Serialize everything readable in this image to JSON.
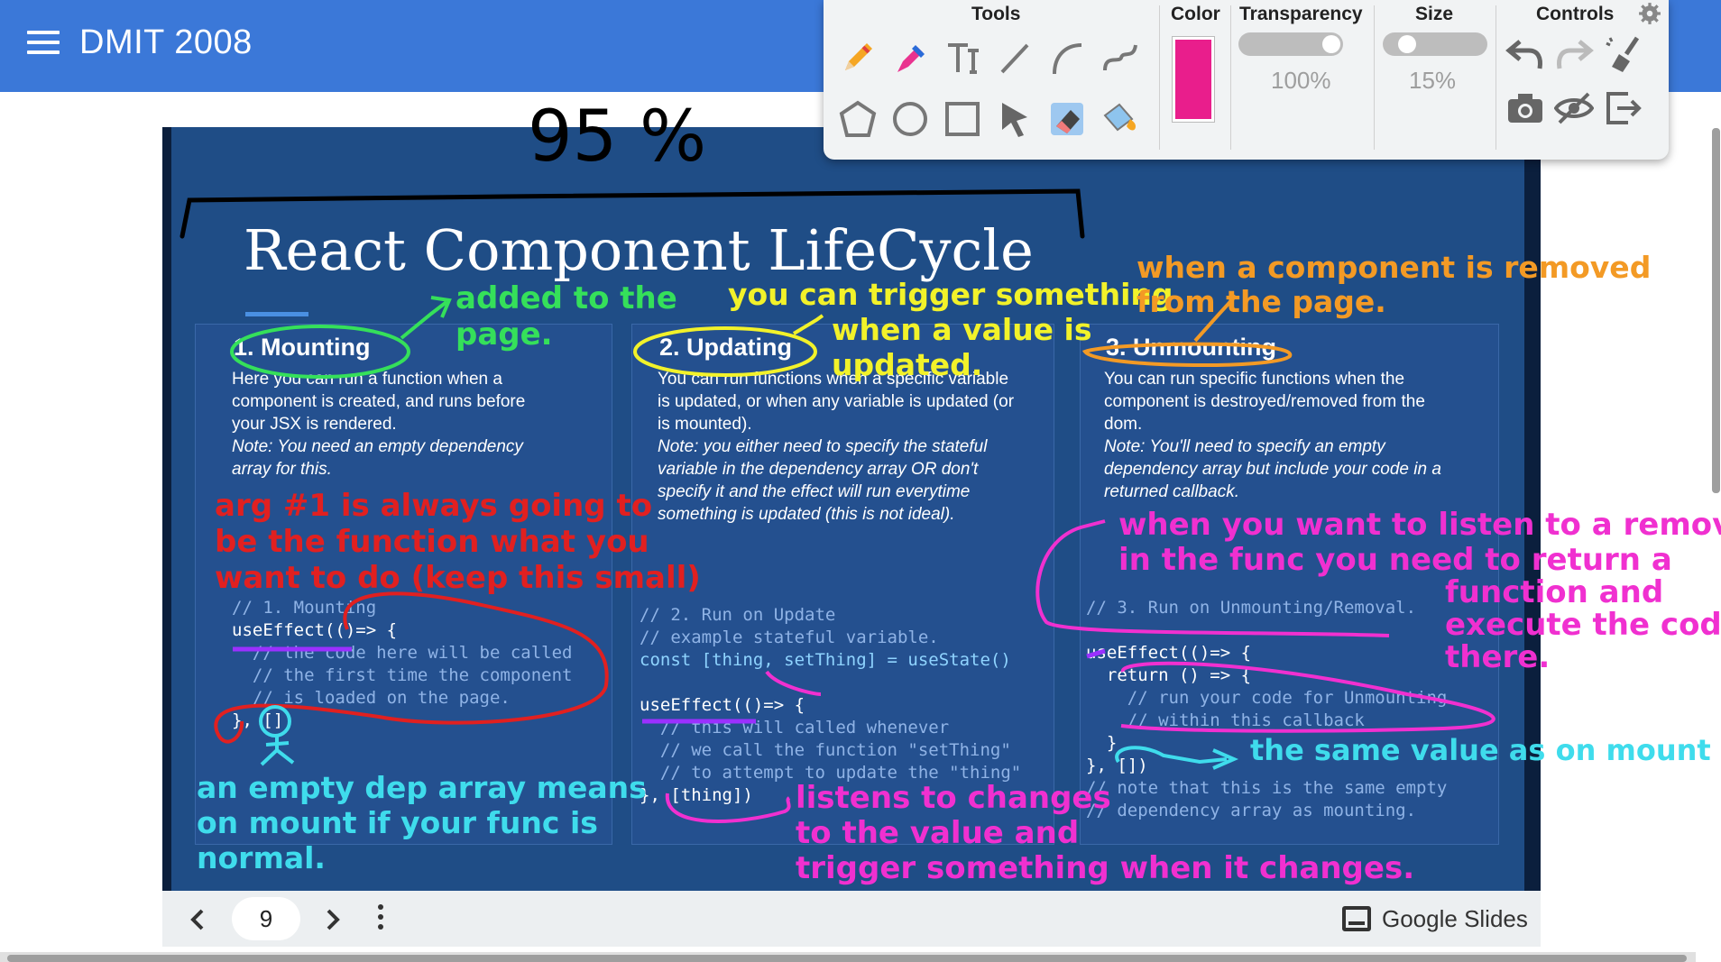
{
  "appbar": {
    "title": "DMIT 2008",
    "menu_icon": "hamburger-menu-icon",
    "color": "#3b78d8"
  },
  "slide": {
    "title": "React Component LifeCycle",
    "cards": [
      {
        "heading": "1. Mounting",
        "description": "Here you can run a function when a component is created, and runs before your JSX is rendered.",
        "note": "Note: You need an empty dependency array for this.",
        "code": [
          "// 1. Mounting",
          "useEffect(()=> {",
          "  // the code here will be called",
          "  // the first time the component",
          "  // is loaded on the page.",
          "}, [])"
        ]
      },
      {
        "heading": "2. Updating",
        "description": "You can run functions when a specific variable is updated, or when any variable is updated (or is mounted).",
        "note": "Note: you either need to specify the stateful variable in the dependency array OR don't specify it and the effect will run everytime something is updated (this is not ideal).",
        "code": [
          "// 2. Run on Update",
          "// example stateful variable.",
          "const [thing, setThing] = useState()",
          "",
          "useEffect(()=> {",
          "  // this will called whenever",
          "  // we call the function \"setThing\"",
          "  // to attempt to update the \"thing\"",
          "}, [thing])"
        ]
      },
      {
        "heading": "3. Unmounting",
        "description": "You can run specific functions when the component is destroyed/removed from the dom.",
        "note": "Note: You'll need to specify an empty dependency array but include your code in a returned callback.",
        "code": [
          "// 3. Run on Unmounting/Removal.",
          "",
          "useEffect(()=> {",
          "  return () => {",
          "    // run your code for Unmounting",
          "    // within this callback",
          "  }",
          "}, [])",
          "// note that this is the same empty",
          "// dependency array as mounting."
        ]
      }
    ]
  },
  "annotations": {
    "zoom_scrawl": "95 %",
    "added": [
      "added to the",
      "page."
    ],
    "trigger": [
      "you can trigger something",
      "when a value is",
      "updated."
    ],
    "removed": [
      "when a component is removed",
      "from the page."
    ],
    "arg": [
      "arg #1 is always going to",
      "be the function what you",
      "want to do (keep this small)"
    ],
    "empty_dep": [
      "an empty dep array means",
      "on mount if your func is",
      "normal."
    ],
    "listens": [
      "listens to changes",
      "to the value and",
      "trigger something when it changes."
    ],
    "listen_removal": [
      "when you want to listen to a removal",
      "in the func you need to return a",
      "function and",
      "execute the code",
      "there."
    ],
    "same_value": "the same value as on mount"
  },
  "toolbar": {
    "headers": {
      "tools": "Tools",
      "color": "Color",
      "transparency": "Transparency",
      "size": "Size",
      "controls": "Controls"
    },
    "tools": [
      "pen-icon",
      "highlighter-icon",
      "text-icon",
      "line-icon",
      "arc-icon",
      "curve-icon",
      "polygon-icon",
      "circle-icon",
      "rectangle-icon",
      "pointer-icon",
      "eraser-icon",
      "fill-icon"
    ],
    "color": "#e91e8c",
    "transparency_value": "100%",
    "transparency_level": 1.0,
    "size_value": "15%",
    "size_level": 0.15,
    "controls": [
      "undo-icon",
      "redo-icon",
      "clear-icon",
      "camera-icon",
      "hide-icon",
      "exit-icon"
    ],
    "settings_icon": "gear-icon"
  },
  "bottombar": {
    "page": "9",
    "brand": "Google Slides"
  }
}
